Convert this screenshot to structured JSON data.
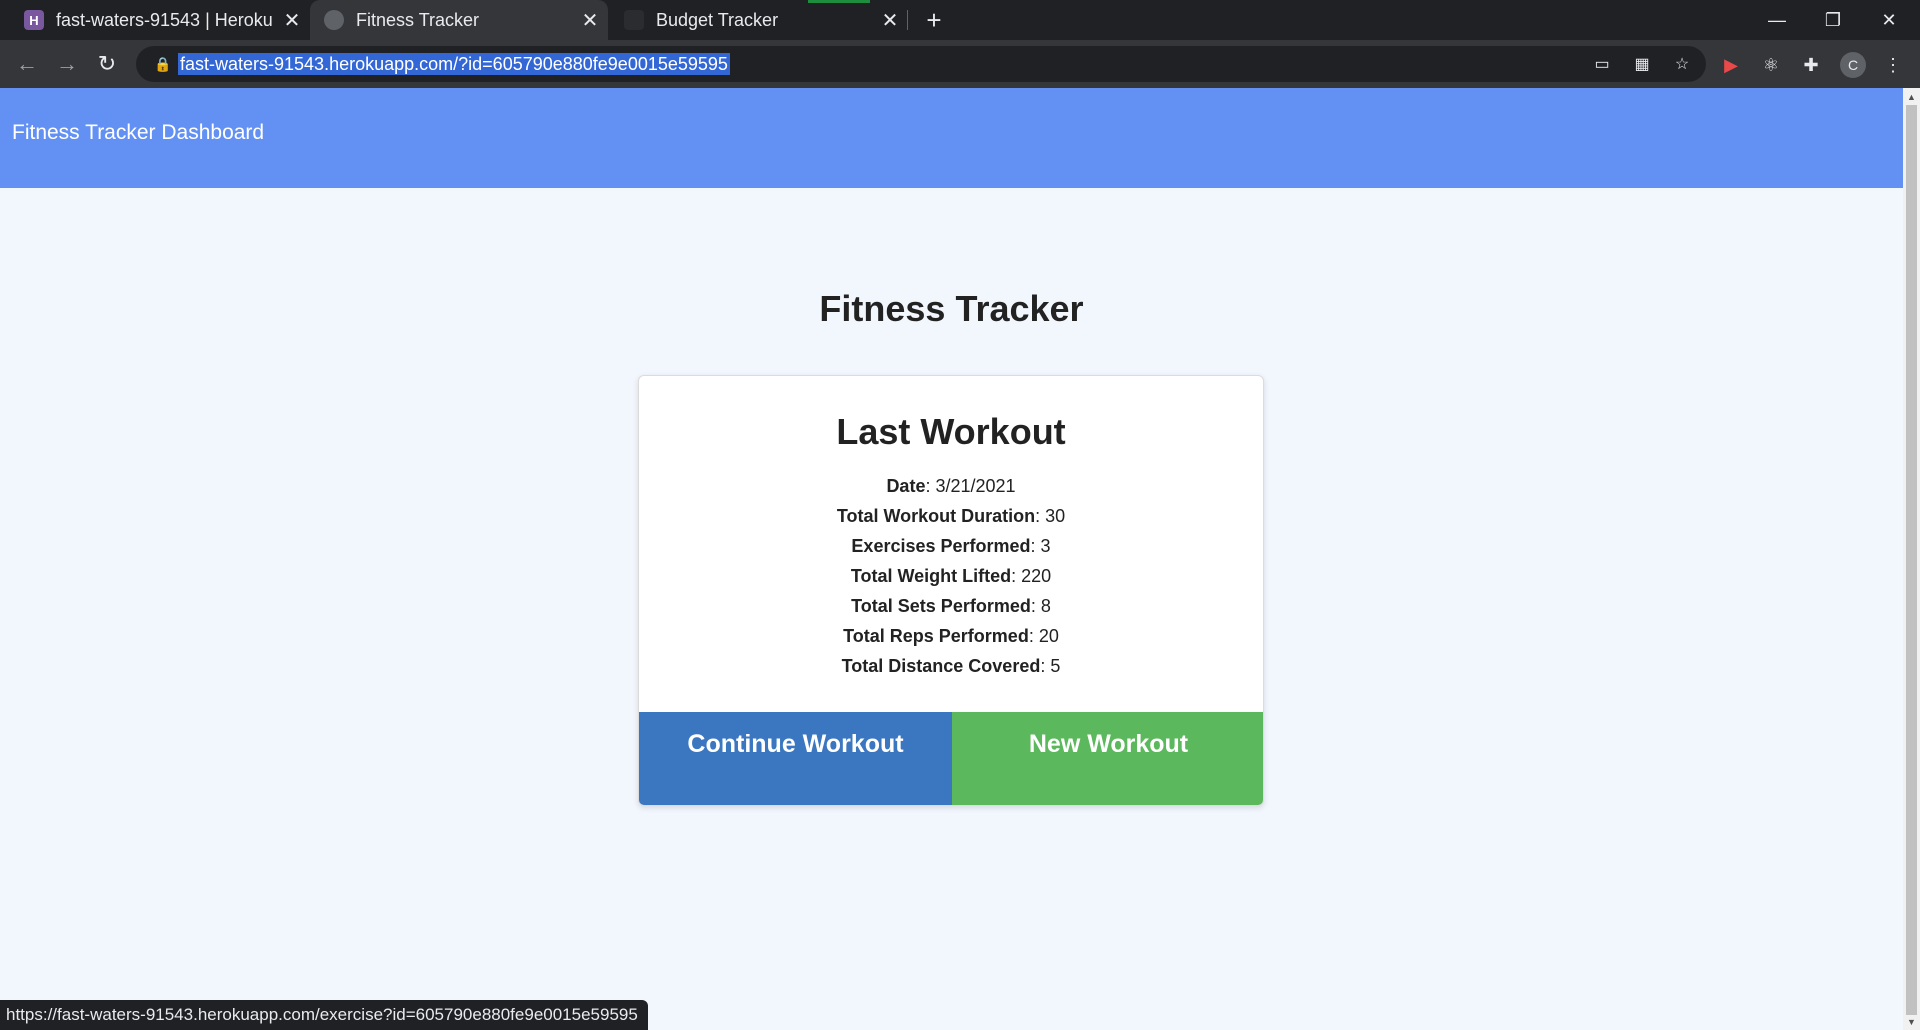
{
  "browser": {
    "tabs": [
      {
        "title": "fast-waters-91543 | Heroku",
        "favicon": "heroku-logo"
      },
      {
        "title": "Fitness Tracker",
        "favicon": "globe-icon"
      },
      {
        "title": "Budget Tracker",
        "favicon": "budget-logo"
      }
    ],
    "tab_icons": {
      "heroku": "H"
    },
    "new_tab": "+",
    "url": "fast-waters-91543.herokuapp.com/?id=605790e880fe9e0015e59595",
    "profile_initial": "C",
    "status_url": "https://fast-waters-91543.herokuapp.com/exercise?id=605790e880fe9e0015e59595"
  },
  "colors": {
    "header": "#6391f3",
    "continue_button": "#3a77c0",
    "new_button": "#5cb85c",
    "background": "#f2f6fd"
  },
  "page": {
    "brand": "Fitness Tracker Dashboard",
    "title": "Fitness Tracker"
  },
  "card": {
    "title": "Last Workout",
    "stats": [
      {
        "label": "Date",
        "value": "3/21/2021"
      },
      {
        "label": "Total Workout Duration",
        "value": "30"
      },
      {
        "label": "Exercises Performed",
        "value": "3"
      },
      {
        "label": "Total Weight Lifted",
        "value": "220"
      },
      {
        "label": "Total Sets Performed",
        "value": "8"
      },
      {
        "label": "Total Reps Performed",
        "value": "20"
      },
      {
        "label": "Total Distance Covered",
        "value": "5"
      }
    ],
    "continue_label": "Continue Workout",
    "new_label": "New Workout"
  }
}
